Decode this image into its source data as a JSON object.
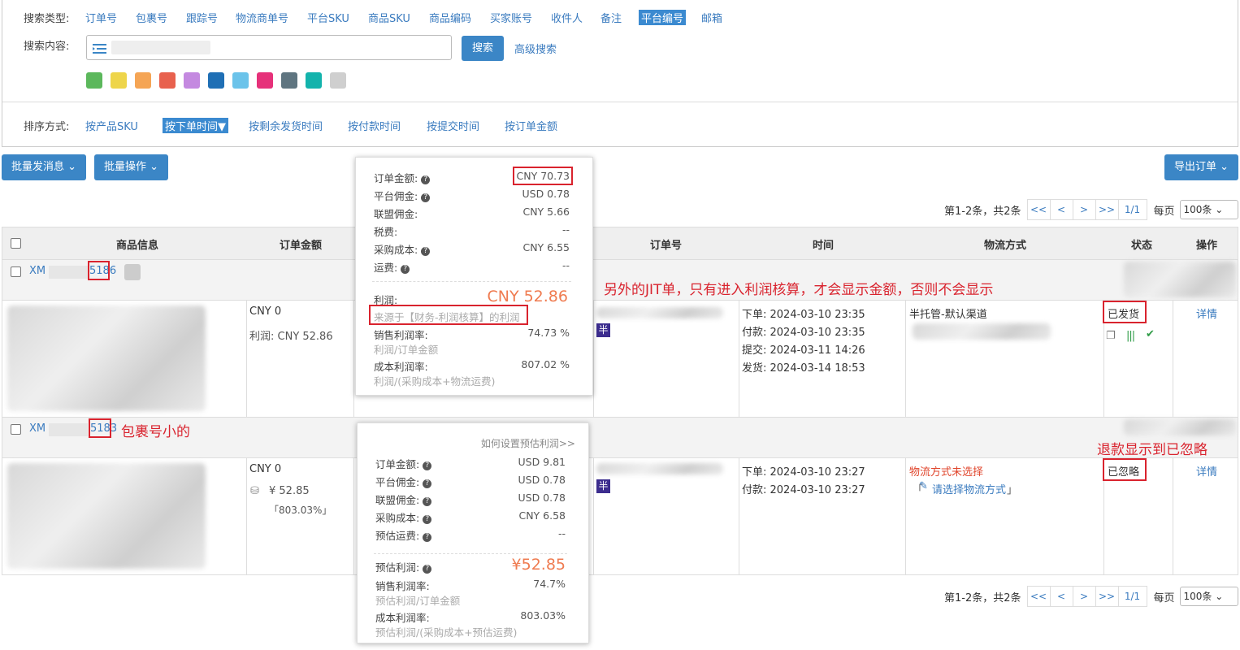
{
  "search": {
    "type_label": "搜索类型:",
    "types": [
      "订单号",
      "包裹号",
      "跟踪号",
      "物流商单号",
      "平台SKU",
      "商品SKU",
      "商品编码",
      "买家账号",
      "收件人",
      "备注",
      "平台编号",
      "邮箱"
    ],
    "active_type": "平台编号",
    "content_label": "搜索内容:",
    "search_button": "搜索",
    "advanced_link": "高级搜索",
    "color_tags": [
      "#5cb85c",
      "#eed54a",
      "#f5a555",
      "#e8614e",
      "#c489e0",
      "#1f6fb5",
      "#6bc3ea",
      "#e6317a",
      "#5f7580",
      "#13b3ac",
      "#cfcfcf"
    ]
  },
  "sort": {
    "label": "排序方式:",
    "options": [
      "按产品SKU",
      "按下单时间▼",
      "按剩余发货时间",
      "按付款时间",
      "按提交时间",
      "按订单金额"
    ],
    "active": "按下单时间▼"
  },
  "toolbar": {
    "batch_message": "批量发消息",
    "batch_ops": "批量操作",
    "export": "导出订单"
  },
  "pager": {
    "summary": "第1-2条，共2条",
    "first": "<<",
    "prev": "<",
    "next": ">",
    "last": ">>",
    "page": "1/1",
    "per_page_label": "每页",
    "per_page": "100条"
  },
  "table": {
    "headers": [
      "商品信息",
      "订单金额",
      "订单号",
      "时间",
      "物流方式",
      "状态",
      "操作"
    ]
  },
  "orders": [
    {
      "id_prefix": "XM",
      "id_suffix": "5186",
      "amount": "CNY 0",
      "profit": "利润: CNY 52.86",
      "times": [
        "下单: 2024-03-10 23:35",
        "付款: 2024-03-10 23:35",
        "提交: 2024-03-11 14:26",
        "发货: 2024-03-14 18:53"
      ],
      "shipping": "半托管-默认渠道",
      "status": "已发货",
      "action": "详情",
      "badge": "半"
    },
    {
      "id_prefix": "XM",
      "id_suffix": "5183",
      "amount": "CNY 0",
      "est_profit": "¥ 52.85",
      "est_rate": "「803.03%」",
      "times": [
        "下单: 2024-03-10 23:27",
        "付款: 2024-03-10 23:27"
      ],
      "shipping_warn": "物流方式未选择",
      "shipping_choose_pre": "「",
      "shipping_choose": "请选择物流方式",
      "shipping_choose_post": "」",
      "status": "已忽略",
      "action": "详情",
      "badge": "半"
    }
  ],
  "popup1": {
    "rows": [
      {
        "k": "订单金额:",
        "v": "CNY 70.73",
        "q": true
      },
      {
        "k": "平台佣金:",
        "v": "USD 0.78",
        "q": true
      },
      {
        "k": "联盟佣金:",
        "v": "CNY 5.66",
        "q": false
      },
      {
        "k": "税费:",
        "v": "--",
        "q": false
      },
      {
        "k": "采购成本:",
        "v": "CNY 6.55",
        "q": true
      },
      {
        "k": "运费:",
        "v": "--",
        "q": true
      }
    ],
    "profit_label": "利润:",
    "profit_value": "CNY 52.86",
    "profit_source": "来源于【财务-利润核算】的利润",
    "sales_rate_label": "销售利润率:",
    "sales_rate_value": "74.73 %",
    "sales_rate_sub": "利润/订单金额",
    "cost_rate_label": "成本利润率:",
    "cost_rate_value": "807.02 %",
    "cost_rate_sub": "利润/(采购成本+物流运费)"
  },
  "popup2": {
    "howto": "如何设置预估利润>>",
    "rows": [
      {
        "k": "订单金额:",
        "v": "USD 9.81",
        "q": true
      },
      {
        "k": "平台佣金:",
        "v": "USD 0.78",
        "q": true
      },
      {
        "k": "联盟佣金:",
        "v": "USD 0.78",
        "q": true
      },
      {
        "k": "采购成本:",
        "v": "CNY 6.58",
        "q": true
      },
      {
        "k": "预估运费:",
        "v": "--",
        "q": true
      }
    ],
    "profit_label": "预估利润:",
    "profit_value": "¥52.85",
    "sales_rate_label": "销售利润率:",
    "sales_rate_value": "74.7%",
    "sales_rate_sub": "预估利润/订单金额",
    "cost_rate_label": "成本利润率:",
    "cost_rate_value": "803.03%",
    "cost_rate_sub": "预估利润/(采购成本+预估运费)"
  },
  "annotations": {
    "jit_note": "另外的JIT单，只有进入利润核算，才会显示金额，否则不会显示",
    "small_pkg": "包裹号小的",
    "refund_note": "退款显示到已忽略"
  }
}
